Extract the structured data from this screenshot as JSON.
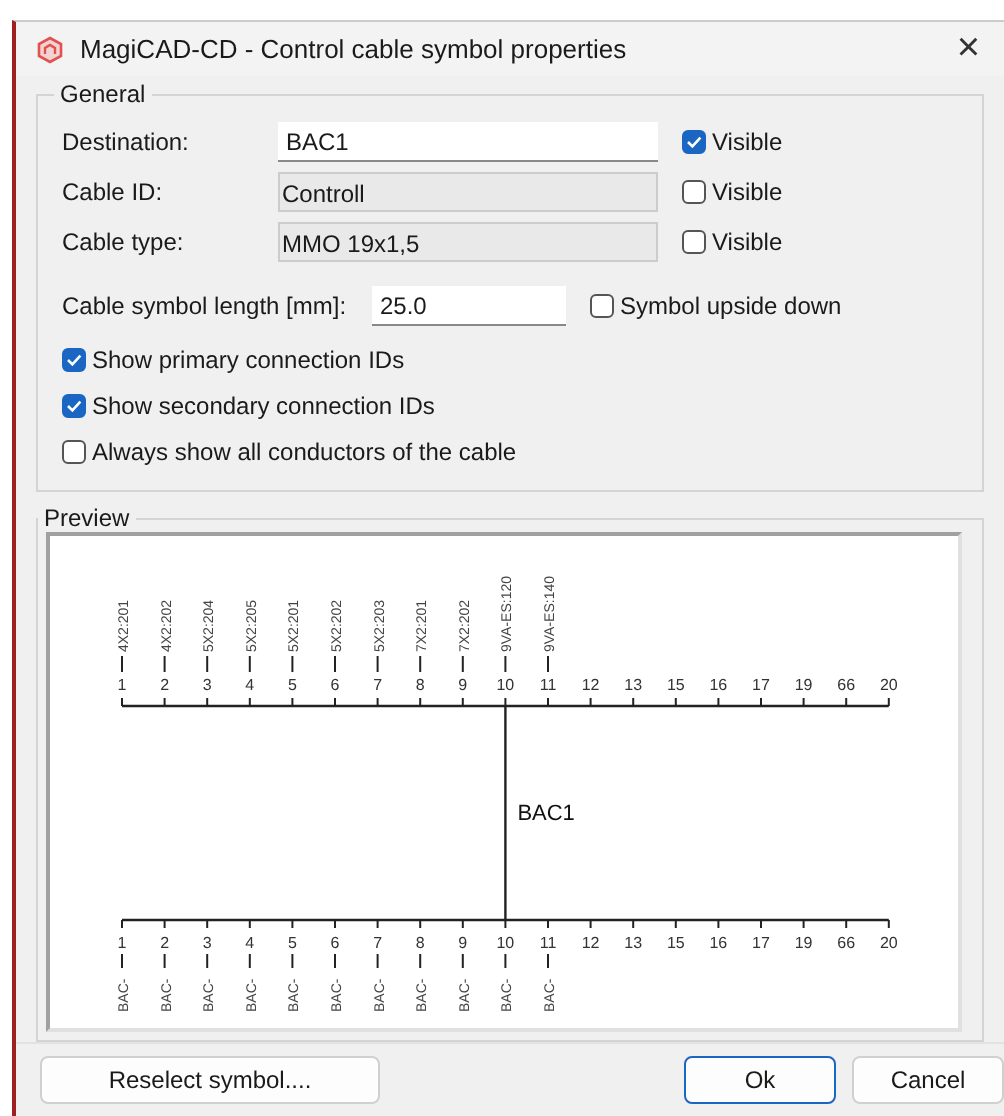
{
  "window": {
    "title": "MagiCAD-CD - Control cable symbol properties",
    "close": "×"
  },
  "general": {
    "title": "General",
    "fields": [
      {
        "label": "Destination:",
        "value": "BAC1",
        "disabled": false,
        "visible_label": "Visible",
        "visible": true
      },
      {
        "label": "Cable ID:",
        "value": "Controll",
        "disabled": true,
        "visible_label": "Visible",
        "visible": false
      },
      {
        "label": "Cable type:",
        "value": "MMO 19x1,5",
        "disabled": true,
        "visible_label": "Visible",
        "visible": false
      }
    ],
    "length": {
      "label": "Cable symbol length [mm]:",
      "value": "25.0",
      "option_label": "Symbol upside down",
      "option_checked": false
    },
    "options": [
      {
        "label": "Show primary connection IDs",
        "checked": true
      },
      {
        "label": "Show secondary connection IDs",
        "checked": true
      },
      {
        "label": "Always show all conductors of the cable",
        "checked": false
      }
    ]
  },
  "preview": {
    "title": "Preview",
    "center_label": "BAC1",
    "top_terminals": [
      {
        "number": "1",
        "label": "4X2:201"
      },
      {
        "number": "2",
        "label": "4X2:202"
      },
      {
        "number": "3",
        "label": "5X2:204"
      },
      {
        "number": "4",
        "label": "5X2:205"
      },
      {
        "number": "5",
        "label": "5X2:201"
      },
      {
        "number": "6",
        "label": "5X2:202"
      },
      {
        "number": "7",
        "label": "5X2:203"
      },
      {
        "number": "8",
        "label": "7X2:201"
      },
      {
        "number": "9",
        "label": "7X2:202"
      },
      {
        "number": "10",
        "label": "9VA-ES:120"
      },
      {
        "number": "11",
        "label": "9VA-ES:140"
      },
      {
        "number": "12"
      },
      {
        "number": "13"
      },
      {
        "number": "15"
      },
      {
        "number": "16"
      },
      {
        "number": "17"
      },
      {
        "number": "19"
      },
      {
        "number": "66"
      },
      {
        "number": "20"
      }
    ],
    "bottom_terminals": [
      {
        "number": "1",
        "label": "BAC-"
      },
      {
        "number": "2",
        "label": "BAC-"
      },
      {
        "number": "3",
        "label": "BAC-"
      },
      {
        "number": "4",
        "label": "BAC-"
      },
      {
        "number": "5",
        "label": "BAC-"
      },
      {
        "number": "6",
        "label": "BAC-"
      },
      {
        "number": "7",
        "label": "BAC-"
      },
      {
        "number": "8",
        "label": "BAC-"
      },
      {
        "number": "9",
        "label": "BAC-"
      },
      {
        "number": "10",
        "label": "BAC-"
      },
      {
        "number": "11",
        "label": "BAC-"
      },
      {
        "number": "12"
      },
      {
        "number": "13"
      },
      {
        "number": "15"
      },
      {
        "number": "16"
      },
      {
        "number": "17"
      },
      {
        "number": "19"
      },
      {
        "number": "66"
      },
      {
        "number": "20"
      }
    ]
  },
  "buttons": [
    {
      "label": "Reselect symbol....",
      "kind": "secondary"
    },
    {
      "label": "Ok",
      "kind": "default"
    },
    {
      "label": "Cancel",
      "kind": "secondary"
    }
  ]
}
